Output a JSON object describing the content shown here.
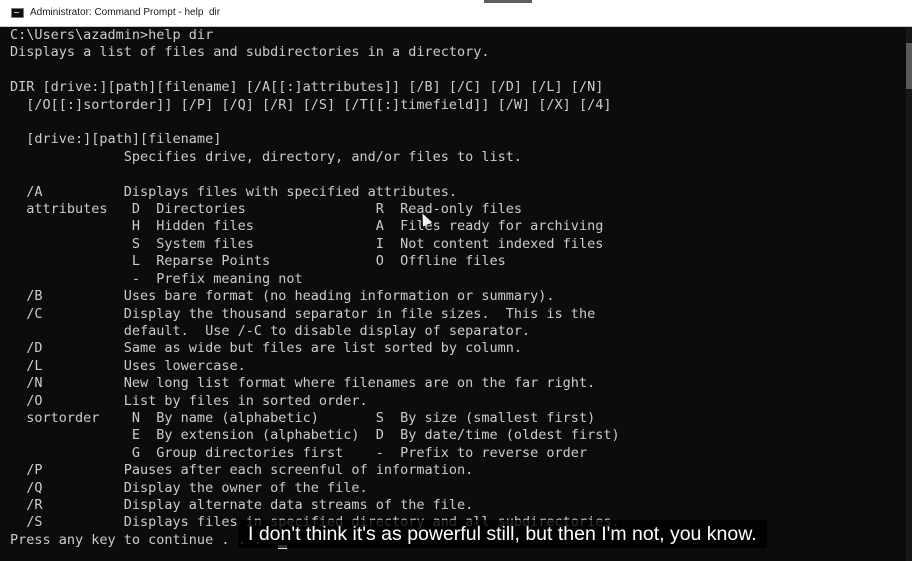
{
  "window": {
    "title": "Administrator: Command Prompt - help  dir"
  },
  "console": {
    "lines": [
      "C:\\Users\\azadmin>help dir",
      "Displays a list of files and subdirectories in a directory.",
      "",
      "DIR [drive:][path][filename] [/A[[:]attributes]] [/B] [/C] [/D] [/L] [/N]",
      "  [/O[[:]sortorder]] [/P] [/Q] [/R] [/S] [/T[[:]timefield]] [/W] [/X] [/4]",
      "",
      "  [drive:][path][filename]",
      "              Specifies drive, directory, and/or files to list.",
      "",
      "  /A          Displays files with specified attributes.",
      "  attributes   D  Directories                R  Read-only files",
      "               H  Hidden files               A  Files ready for archiving",
      "               S  System files               I  Not content indexed files",
      "               L  Reparse Points             O  Offline files",
      "               -  Prefix meaning not",
      "  /B          Uses bare format (no heading information or summary).",
      "  /C          Display the thousand separator in file sizes.  This is the",
      "              default.  Use /-C to disable display of separator.",
      "  /D          Same as wide but files are list sorted by column.",
      "  /L          Uses lowercase.",
      "  /N          New long list format where filenames are on the far right.",
      "  /O          List by files in sorted order.",
      "  sortorder    N  By name (alphabetic)       S  By size (smallest first)",
      "               E  By extension (alphabetic)  D  By date/time (oldest first)",
      "               G  Group directories first    -  Prefix to reverse order",
      "  /P          Pauses after each screenful of information.",
      "  /Q          Display the owner of the file.",
      "  /R          Display alternate data streams of the file.",
      "  /S          Displays files in specified directory and all subdirectories.",
      "Press any key to continue . . ."
    ]
  },
  "caption": {
    "text": "I don't think it's as powerful still, but then I'm not, you know."
  },
  "colors": {
    "console_background": "#0c0c0c",
    "console_text": "#cccccc",
    "caption_text": "#ffffff"
  }
}
